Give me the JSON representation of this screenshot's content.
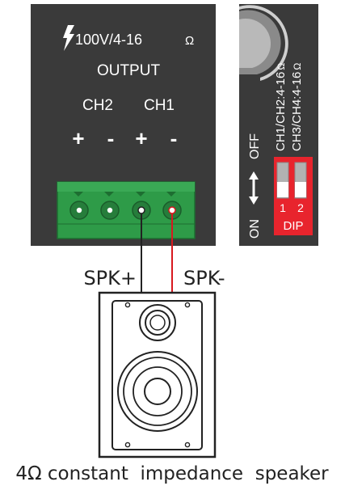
{
  "output_panel": {
    "rating_label": "100V/4-16",
    "ohm_symbol": "Ω",
    "output_label": "OUTPUT",
    "channels": [
      "CH2",
      "CH1"
    ],
    "polarity": [
      "+",
      "-",
      "+",
      "-"
    ]
  },
  "dip_panel": {
    "ch12_label": "CH1/CH2:4-16",
    "ch34_label": "CH3/CH4:4-16",
    "ohm_symbol": "Ω",
    "off_label": "OFF",
    "on_label": "ON",
    "switch_numbers": [
      "1",
      "2"
    ],
    "dip_label": "DIP"
  },
  "wiring": {
    "spk_plus_label": "SPK+",
    "spk_minus_label": "SPK-"
  },
  "caption": "4Ω constant  impedance  speaker",
  "colors": {
    "panel": "#3a3a3a",
    "terminal_green": "#2e9b48",
    "dip_red": "#e8242d",
    "wire_red": "#d8181f",
    "wire_black": "#222222"
  }
}
